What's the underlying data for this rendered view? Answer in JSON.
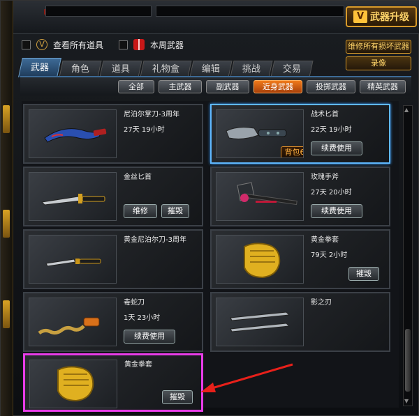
{
  "top": {
    "upgrade_label": "武器升级"
  },
  "filters": {
    "view_all_label": "查看所有道具",
    "weekly_label": "本周武器"
  },
  "side_buttons": {
    "repair_all": "维修所有损坏武器",
    "record": "录像"
  },
  "tabs": [
    {
      "label": "武器",
      "active": true
    },
    {
      "label": "角色",
      "active": false
    },
    {
      "label": "道具",
      "active": false
    },
    {
      "label": "礼物盒",
      "active": false
    },
    {
      "label": "编辑",
      "active": false
    },
    {
      "label": "挑战",
      "active": false
    },
    {
      "label": "交易",
      "active": false
    }
  ],
  "subtabs": [
    {
      "label": "全部",
      "active": false
    },
    {
      "label": "主武器",
      "active": false
    },
    {
      "label": "副武器",
      "active": false
    },
    {
      "label": "近身武器",
      "active": true
    },
    {
      "label": "投掷武器",
      "active": false
    },
    {
      "label": "精英武器",
      "active": false
    }
  ],
  "items": [
    {
      "name": "尼泊尔掌刀-3周年",
      "time": "27天 19小时",
      "button": "",
      "bag": "",
      "selected": false,
      "highlighted": false,
      "icon": "kukri-icon"
    },
    {
      "name": "战术匕首",
      "time": "22天 19小时",
      "button": "续费使用",
      "bag": "背包6",
      "selected": true,
      "highlighted": false,
      "icon": "tactical-knife-icon"
    },
    {
      "name": "金丝匕首",
      "time": "",
      "button": "维修",
      "button2": "摧毁",
      "bag": "",
      "selected": false,
      "highlighted": false,
      "icon": "gold-dagger-icon"
    },
    {
      "name": "玫瑰手斧",
      "time": "27天 20小时",
      "button": "续费使用",
      "bag": "",
      "selected": false,
      "highlighted": false,
      "icon": "rose-axe-icon"
    },
    {
      "name": "黄金尼泊尔刀-3周年",
      "time": "",
      "button": "",
      "bag": "",
      "selected": false,
      "highlighted": false,
      "icon": "knife-icon"
    },
    {
      "name": "黄金拳套",
      "time": "79天 2小时",
      "button": "摧毁",
      "bag": "",
      "selected": false,
      "highlighted": false,
      "icon": "gold-fist-icon"
    },
    {
      "name": "毒蛇刀",
      "time": "1天 23小时",
      "button": "续费使用",
      "bag": "",
      "selected": false,
      "highlighted": false,
      "icon": "serpent-blade-icon"
    },
    {
      "name": "影之刃",
      "time": "",
      "button": "",
      "bag": "",
      "selected": false,
      "highlighted": false,
      "icon": "twin-blades-icon"
    },
    {
      "name": "黄金拳套",
      "time": "",
      "button": "摧毁",
      "bag": "",
      "selected": false,
      "highlighted": true,
      "icon": "gold-fist-icon"
    }
  ],
  "colors": {
    "accent_blue": "#5fb8ff",
    "highlight_magenta": "#e83ce8",
    "orange_active": "#f07a1a",
    "gold": "#ffd46a"
  }
}
